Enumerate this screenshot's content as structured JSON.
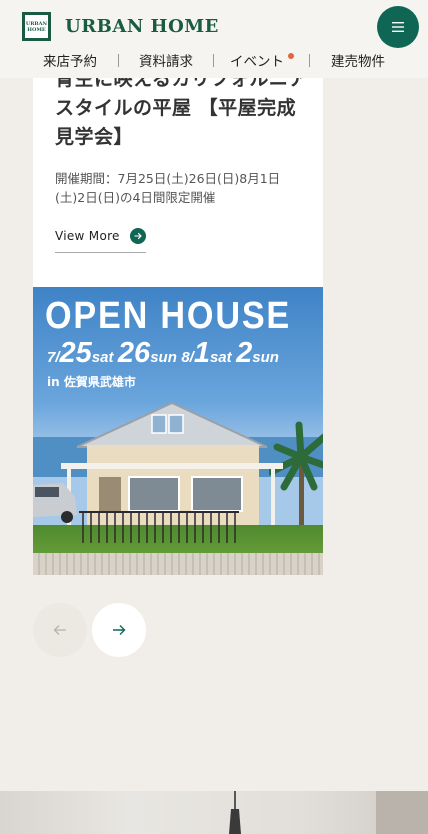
{
  "header": {
    "logo_mark_lines": [
      "URBAN",
      "HOME"
    ],
    "logo_text": "URBAN HOME",
    "menu_icon": "hamburger-icon",
    "nav": [
      {
        "label": "来店予約"
      },
      {
        "label": "資料請求"
      },
      {
        "label": "イベント",
        "has_dot": true
      },
      {
        "label": "建売物件"
      }
    ]
  },
  "event_card": {
    "title": "青空に映えるカリフォルニアスタイルの平屋 【平屋完成見学会】",
    "date_text": "開催期間：7月25日(土)26日(日)8月1日(土)2日(日)の4日間限定開催",
    "link_label": "View More",
    "link_icon": "arrow-right-icon",
    "banner": {
      "title": "OPEN HOUSE",
      "dates": [
        {
          "n": "7",
          "sep": "/",
          "d": "25",
          "w": "sat"
        },
        {
          "d": "26",
          "w": "sun"
        },
        {
          "n": "8",
          "sep": "/",
          "d": "1",
          "w": "sat"
        },
        {
          "d": "2",
          "w": "sun"
        }
      ],
      "location": "in 佐賀県武雄市"
    }
  },
  "slider": {
    "prev_icon": "arrow-left-icon",
    "next_icon": "arrow-right-icon"
  },
  "colors": {
    "brand_green": "#1a5b45",
    "button_green": "#0f6654",
    "accent_orange": "#e2653f",
    "page_bg": "#f1eee9"
  }
}
